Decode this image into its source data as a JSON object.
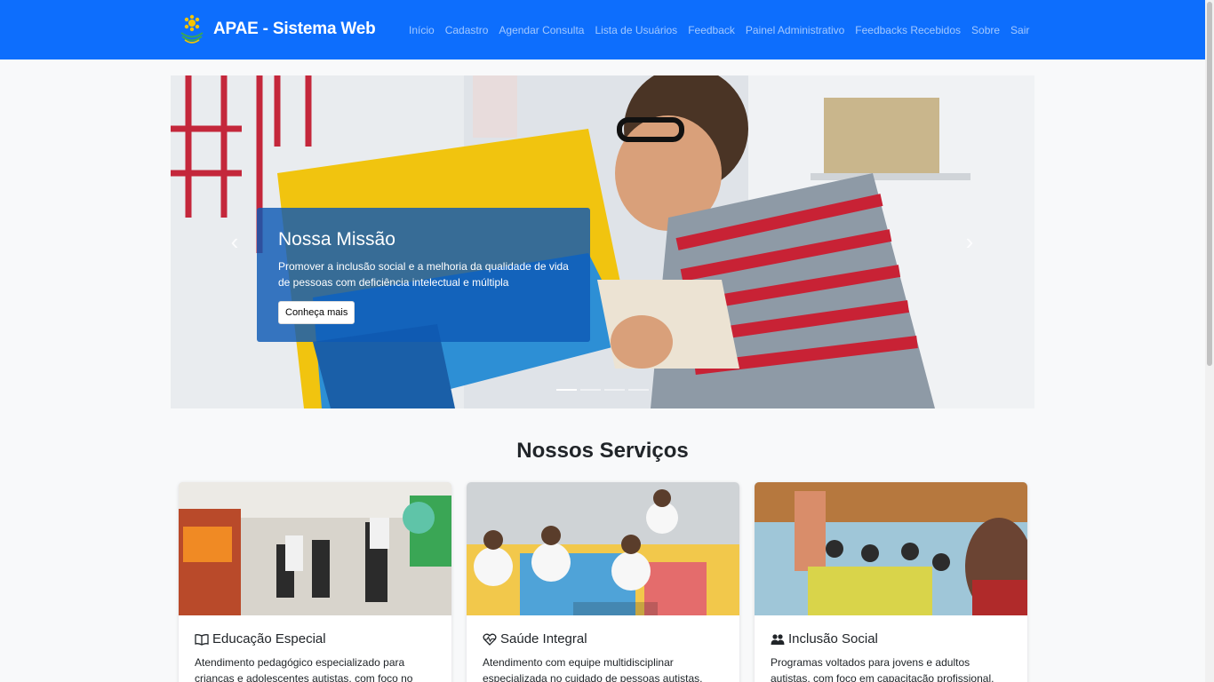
{
  "navbar": {
    "brand": "APAE - Sistema Web",
    "links": [
      "Início",
      "Cadastro",
      "Agendar Consulta",
      "Lista de Usuários",
      "Feedback",
      "Painel Administrativo",
      "Feedbacks Recebidos",
      "Sobre",
      "Sair"
    ]
  },
  "carousel": {
    "title": "Nossa Missão",
    "text": "Promover a inclusão social e a melhoria da qualidade de vida de pessoas com deficiência intelectual e múltipla",
    "button": "Conheça mais",
    "slides": 4,
    "active_slide": 1,
    "prev_icon": "chevron-left-icon",
    "next_icon": "chevron-right-icon"
  },
  "services": {
    "title": "Nossos Serviços",
    "cards": [
      {
        "icon": "book-icon",
        "title": "Educação Especial",
        "text": "Atendimento pedagógico especializado para crianças e adolescentes autistas, com foco no"
      },
      {
        "icon": "heart-pulse-icon",
        "title": "Saúde Integral",
        "text": "Atendimento com equipe multidisciplinar especializada no cuidado de pessoas autistas,"
      },
      {
        "icon": "people-icon",
        "title": "Inclusão Social",
        "text": "Programas voltados para jovens e adultos autistas, com foco em capacitação profissional,"
      }
    ]
  },
  "colors": {
    "primary": "#0d6efd",
    "background": "#f8f9fa"
  }
}
